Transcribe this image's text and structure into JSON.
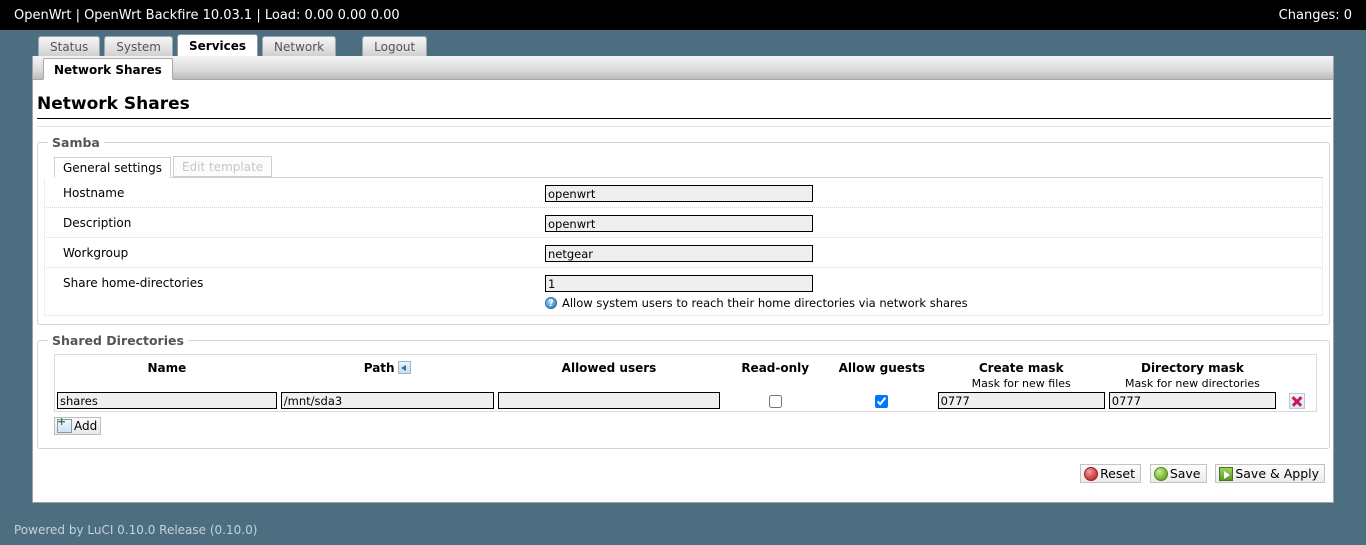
{
  "header": {
    "title": "OpenWrt | OpenWrt Backfire 10.03.1 | Load: 0.00 0.00 0.00",
    "changes": "Changes: 0"
  },
  "mainmenu": [
    {
      "label": "Status",
      "active": false
    },
    {
      "label": "System",
      "active": false
    },
    {
      "label": "Services",
      "active": true
    },
    {
      "label": "Network",
      "active": false
    },
    {
      "label": "Logout",
      "active": false
    }
  ],
  "subtabs": [
    {
      "label": "Network Shares",
      "active": true
    }
  ],
  "page": {
    "title": "Network Shares"
  },
  "samba": {
    "legend": "Samba",
    "tabs": [
      {
        "label": "General settings",
        "state": "active"
      },
      {
        "label": "Edit template",
        "state": "disabled"
      }
    ],
    "fields": [
      {
        "label": "Hostname",
        "value": "openwrt",
        "hint": ""
      },
      {
        "label": "Description",
        "value": "openwrt",
        "hint": ""
      },
      {
        "label": "Workgroup",
        "value": "netgear",
        "hint": ""
      },
      {
        "label": "Share home-directories",
        "value": "1",
        "hint": "Allow system users to reach their home directories via network shares"
      }
    ]
  },
  "shared_directories": {
    "legend": "Shared Directories",
    "columns": [
      {
        "title": "Name",
        "sub": "",
        "sort_icon": false
      },
      {
        "title": "Path",
        "sub": "",
        "sort_icon": true
      },
      {
        "title": "Allowed users",
        "sub": "",
        "sort_icon": false
      },
      {
        "title": "Read-only",
        "sub": "",
        "sort_icon": false
      },
      {
        "title": "Allow guests",
        "sub": "",
        "sort_icon": false
      },
      {
        "title": "Create mask",
        "sub": "Mask for new files",
        "sort_icon": false
      },
      {
        "title": "Directory mask",
        "sub": "Mask for new directories",
        "sort_icon": false
      }
    ],
    "rows": [
      {
        "name": "shares",
        "path": "/mnt/sda3",
        "allowed_users": "",
        "read_only": false,
        "allow_guests": true,
        "create_mask": "0777",
        "directory_mask": "0777"
      }
    ],
    "add_label": "Add",
    "add_icon": "add-icon",
    "remove_icon": "remove-icon"
  },
  "actions": {
    "reset": "Reset",
    "save": "Save",
    "save_apply": "Save & Apply"
  },
  "footer": {
    "text": "Powered by LuCI 0.10.0 Release (0.10.0)"
  },
  "colors": {
    "page_background": "#4c6e80",
    "header_background": "#000000",
    "header_text": "#ffffff",
    "content_background": "#ffffff",
    "input_background": "#efefef",
    "legend_text": "#555555",
    "footer_text": "#c3d2da"
  }
}
